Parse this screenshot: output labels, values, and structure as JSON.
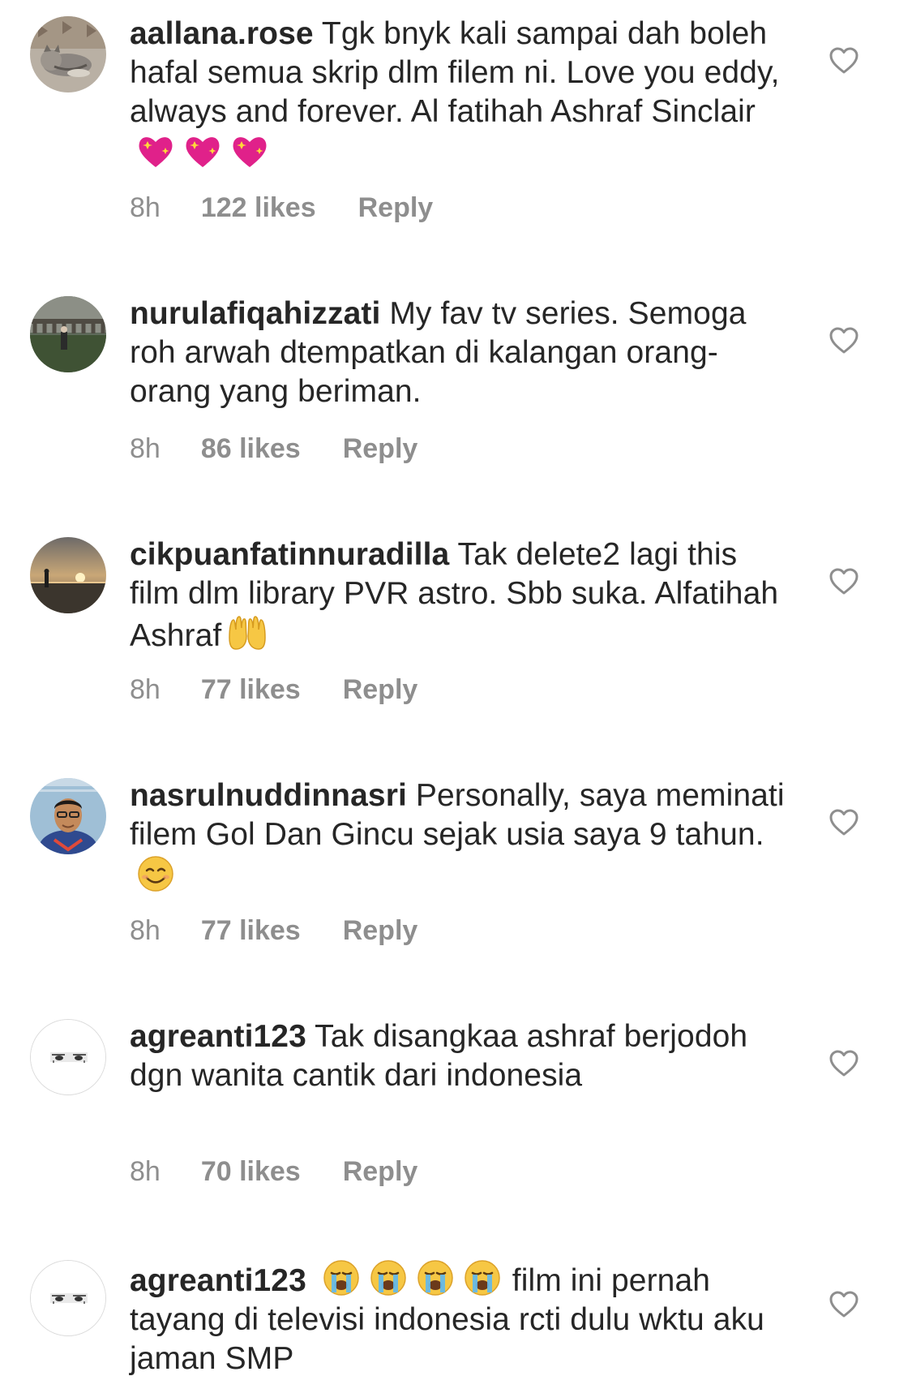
{
  "comments": [
    {
      "username": "aallana.rose",
      "text": " Tgk bnyk kali sampai dah boleh hafal semua skrip dlm filem ni. Love you eddy, always and forever. Al fatihah Ashraf Sinclair",
      "emoji": "sparkling-heart-emoji",
      "emoji_count": 3,
      "time": "8h",
      "likes": "122 likes",
      "reply": "Reply"
    },
    {
      "username": "nurulafiqahizzati",
      "text": " My fav tv series. Semoga roh arwah dtempatkan di kalangan orang-orang yang beriman.",
      "time": "8h",
      "likes": "86 likes",
      "reply": "Reply"
    },
    {
      "username": "cikpuanfatinnuradilla",
      "text": " Tak delete2 lagi this film dlm library PVR astro. Sbb suka. Alfatihah Ashraf",
      "emoji": "raised-palms-emoji",
      "emoji_count": 1,
      "time": "8h",
      "likes": "77 likes",
      "reply": "Reply"
    },
    {
      "username": "nasrulnuddinnasri",
      "text": " Personally, saya meminati filem Gol Dan Gincu sejak usia saya 9 tahun.",
      "emoji": "smiling-face-emoji",
      "emoji_count": 1,
      "time": "8h",
      "likes": "77 likes",
      "reply": "Reply"
    },
    {
      "username": "agreanti123",
      "text": " Tak disangkaa ashraf berjodoh dgn wanita cantik dari indonesia",
      "time": "8h",
      "likes": "70 likes",
      "reply": "Reply"
    },
    {
      "username": "agreanti123",
      "prefix_emoji": "loudly-crying-face-emoji",
      "prefix_emoji_count": 4,
      "text": " film ini pernah tayang di televisi indonesia rcti dulu wktu aku jaman SMP"
    }
  ],
  "icons": {
    "like": "heart-outline-icon"
  },
  "colors": {
    "text": "#262626",
    "secondary": "#8e8e8e",
    "border": "#dbdbdb"
  }
}
